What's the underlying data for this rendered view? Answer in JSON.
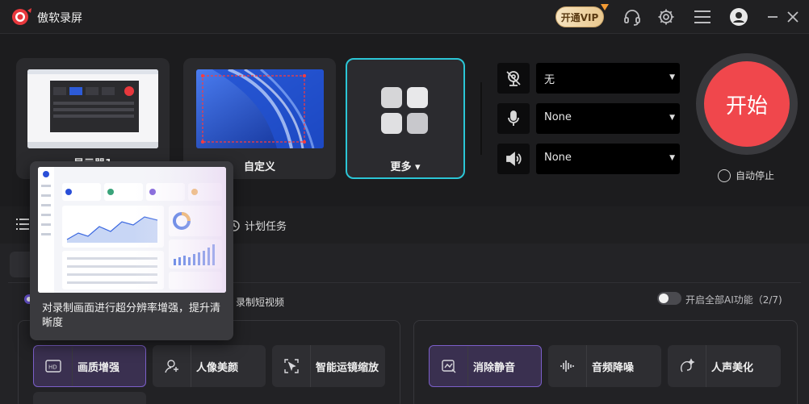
{
  "app": {
    "title": "傲软录屏"
  },
  "titlebar": {
    "vip_label": "开通VIP"
  },
  "sources": [
    {
      "label": "显示器1"
    },
    {
      "label": "自定义"
    },
    {
      "label": "更多 ▾"
    }
  ],
  "devices": {
    "camera": {
      "value": "无"
    },
    "microphone": {
      "value": "None"
    },
    "speaker": {
      "value": "None"
    }
  },
  "record": {
    "start_label": "开始",
    "auto_stop_label": "自动停止"
  },
  "tabs": {
    "scheduled_label": "计划任务",
    "short_video_label": "录制短视频"
  },
  "ai": {
    "toggle_label": "开启全部AI功能（2/7)"
  },
  "tooltip": {
    "text": "对录制画面进行超分辨率增强，提升清晰度"
  },
  "video_features": [
    {
      "label": "画质增强",
      "icon": "hd-icon",
      "active": true
    },
    {
      "label": "人像美颜",
      "icon": "face-sparkle-icon",
      "active": false
    },
    {
      "label": "智能运镜缩放",
      "icon": "cursor-zoom-icon",
      "active": false
    }
  ],
  "audio_features": [
    {
      "label": "消除静音",
      "icon": "mute-remove-icon",
      "active": true
    },
    {
      "label": "音频降噪",
      "icon": "waveform-icon",
      "active": false
    },
    {
      "label": "人声美化",
      "icon": "voice-sparkle-icon",
      "active": false
    }
  ],
  "colors": {
    "accent": "#2bc6d6",
    "record": "#f0474c",
    "feature_active": "#7b5fc9"
  }
}
